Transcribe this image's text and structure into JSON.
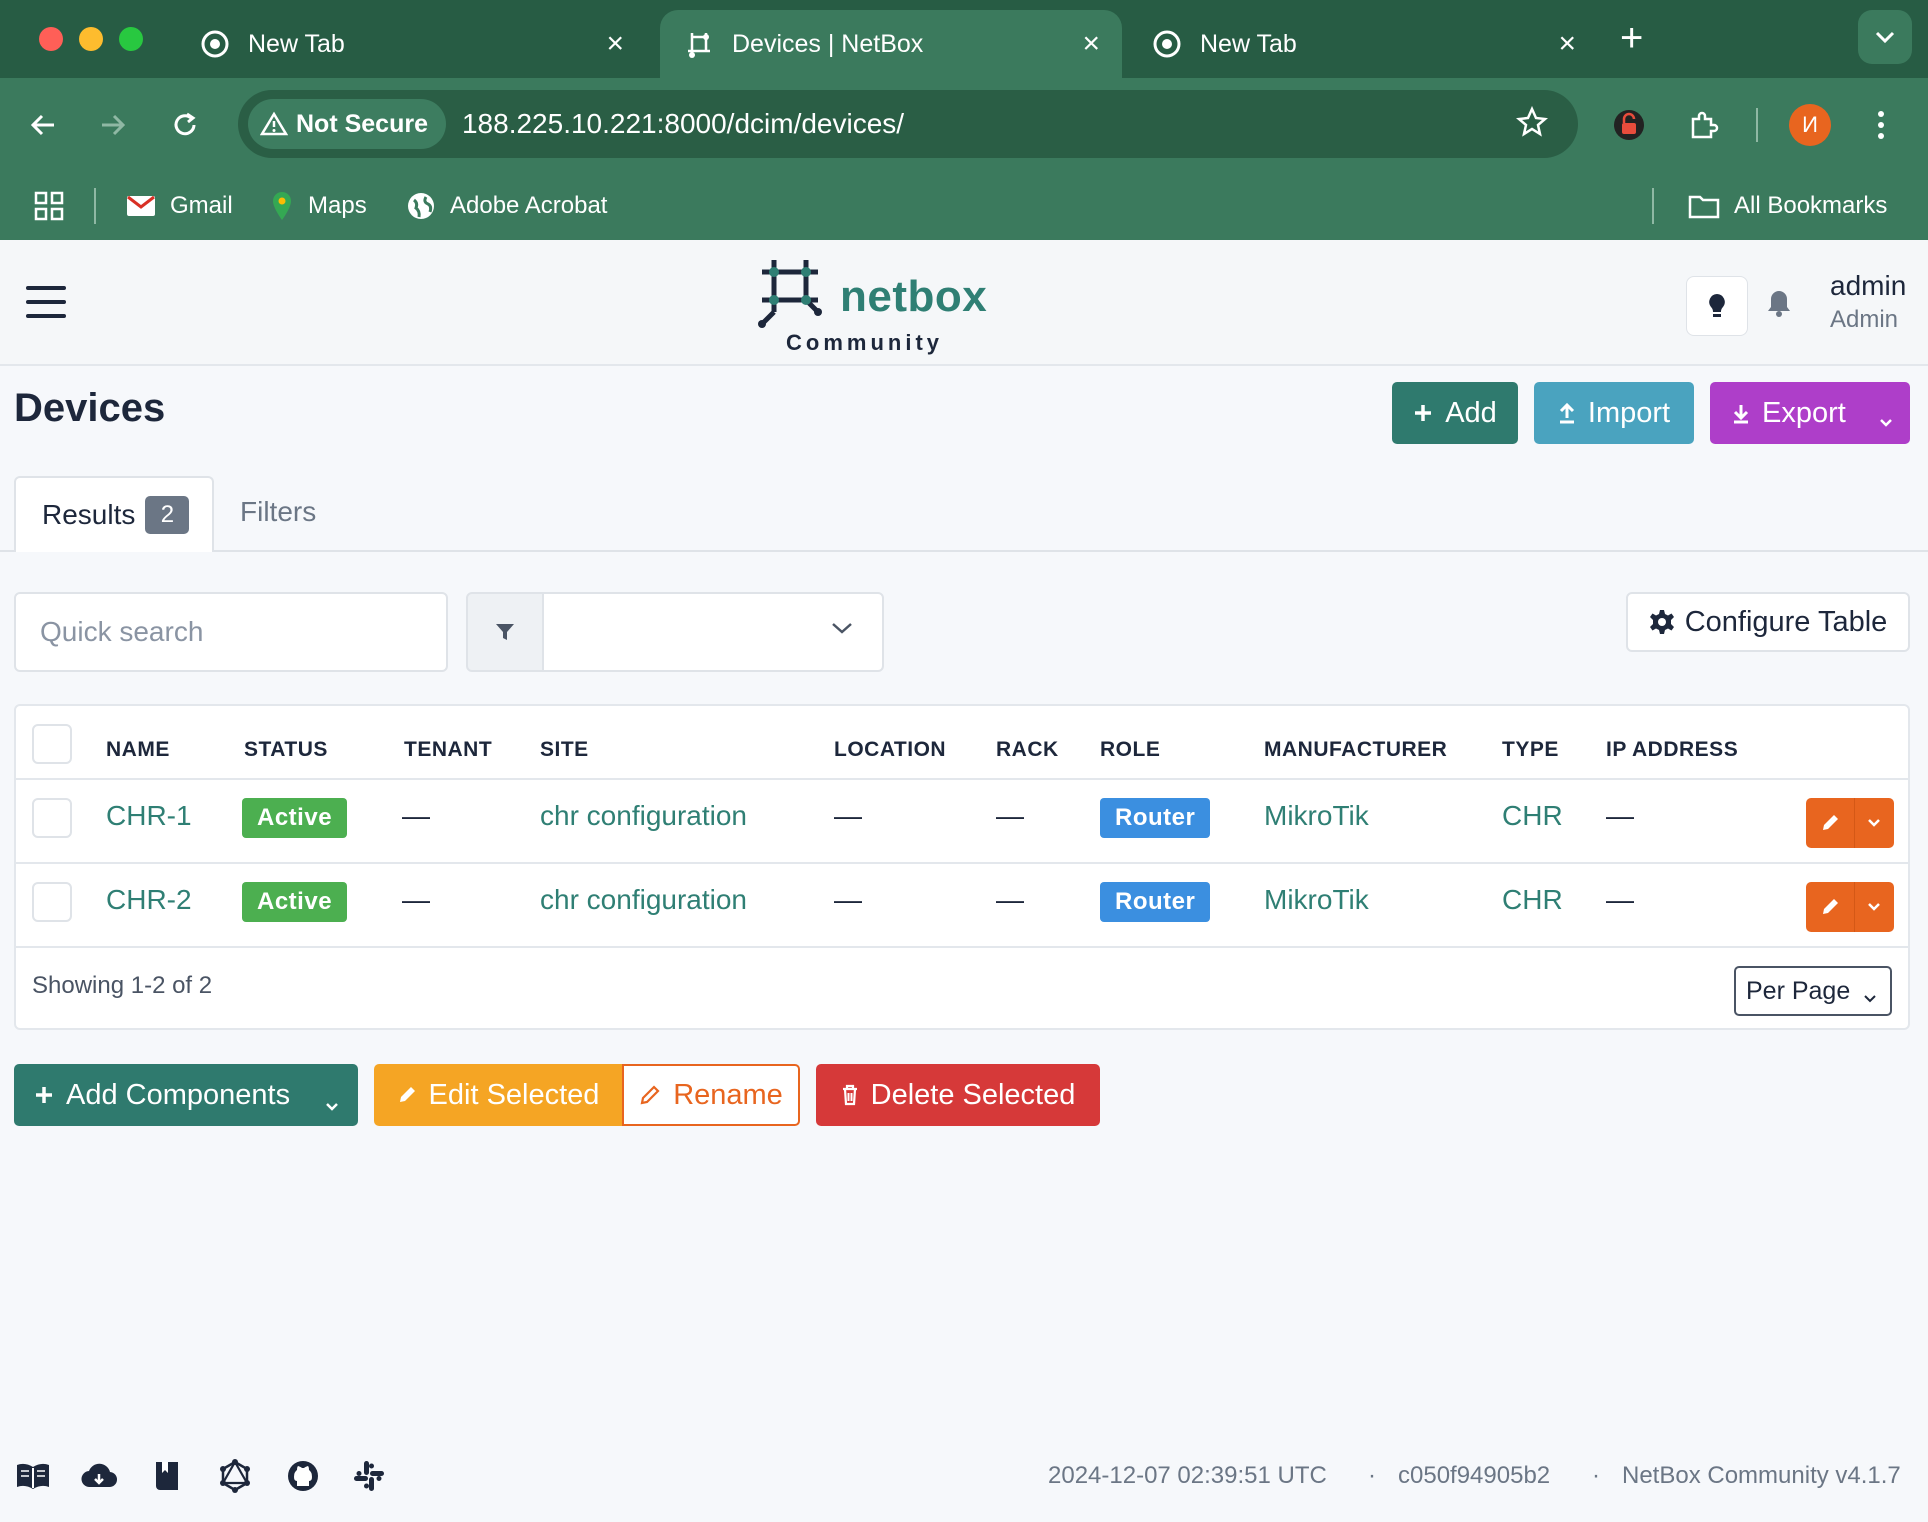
{
  "browser": {
    "tabs": [
      {
        "title": "New Tab",
        "active": false
      },
      {
        "title": "Devices | NetBox",
        "active": true
      },
      {
        "title": "New Tab",
        "active": false
      }
    ],
    "security_label": "Not Secure",
    "url": "188.225.10.221:8000/dcim/devices/",
    "profile_initial": "И",
    "bookmarks": [
      {
        "label": "Gmail",
        "icon": "gmail-icon"
      },
      {
        "label": "Maps",
        "icon": "maps-icon"
      },
      {
        "label": "Adobe Acrobat",
        "icon": "globe-icon"
      }
    ],
    "all_bookmarks_label": "All Bookmarks"
  },
  "header": {
    "logo_word": "netbox",
    "logo_sub": "Community",
    "user_name": "admin",
    "user_role": "Admin"
  },
  "page": {
    "title": "Devices",
    "add_label": "Add",
    "import_label": "Import",
    "export_label": "Export",
    "tabs": {
      "results_label": "Results",
      "results_count": "2",
      "filters_label": "Filters"
    },
    "search_placeholder": "Quick search",
    "filter_value": "",
    "configure_table_label": "Configure Table"
  },
  "table": {
    "columns": [
      "NAME",
      "STATUS",
      "TENANT",
      "SITE",
      "LOCATION",
      "RACK",
      "ROLE",
      "MANUFACTURER",
      "TYPE",
      "IP ADDRESS"
    ],
    "rows": [
      {
        "name": "CHR-1",
        "status": "Active",
        "tenant": "—",
        "site": "chr configuration",
        "location": "—",
        "rack": "—",
        "role": "Router",
        "manufacturer": "MikroTik",
        "type": "CHR",
        "ip_address": "—"
      },
      {
        "name": "CHR-2",
        "status": "Active",
        "tenant": "—",
        "site": "chr configuration",
        "location": "—",
        "rack": "—",
        "role": "Router",
        "manufacturer": "MikroTik",
        "type": "CHR",
        "ip_address": "—"
      }
    ],
    "showing": "Showing 1-2 of 2",
    "per_page_label": "Per Page"
  },
  "bulk_actions": {
    "add_components": "Add Components",
    "edit_selected": "Edit Selected",
    "rename": "Rename",
    "delete_selected": "Delete Selected"
  },
  "footer": {
    "timestamp": "2024-12-07 02:39:51 UTC",
    "separator": "·",
    "commit": "c050f94905b2",
    "version": "NetBox Community v4.1.7",
    "icons": [
      "docs-icon",
      "api-icon",
      "book-icon",
      "graphql-icon",
      "github-icon",
      "slack-icon"
    ]
  },
  "colors": {
    "browser_green": "#3b7a5d",
    "brand_teal": "#2f7f74",
    "add_btn": "#2f7a6e",
    "import_btn": "#4aa3bf",
    "export_btn": "#ae3ec9",
    "edit_btn": "#f59f00",
    "rename_btn": "#e8651f",
    "delete_btn": "#d63939",
    "status_active": "#4caf50",
    "role_router": "#3b8fe0"
  }
}
